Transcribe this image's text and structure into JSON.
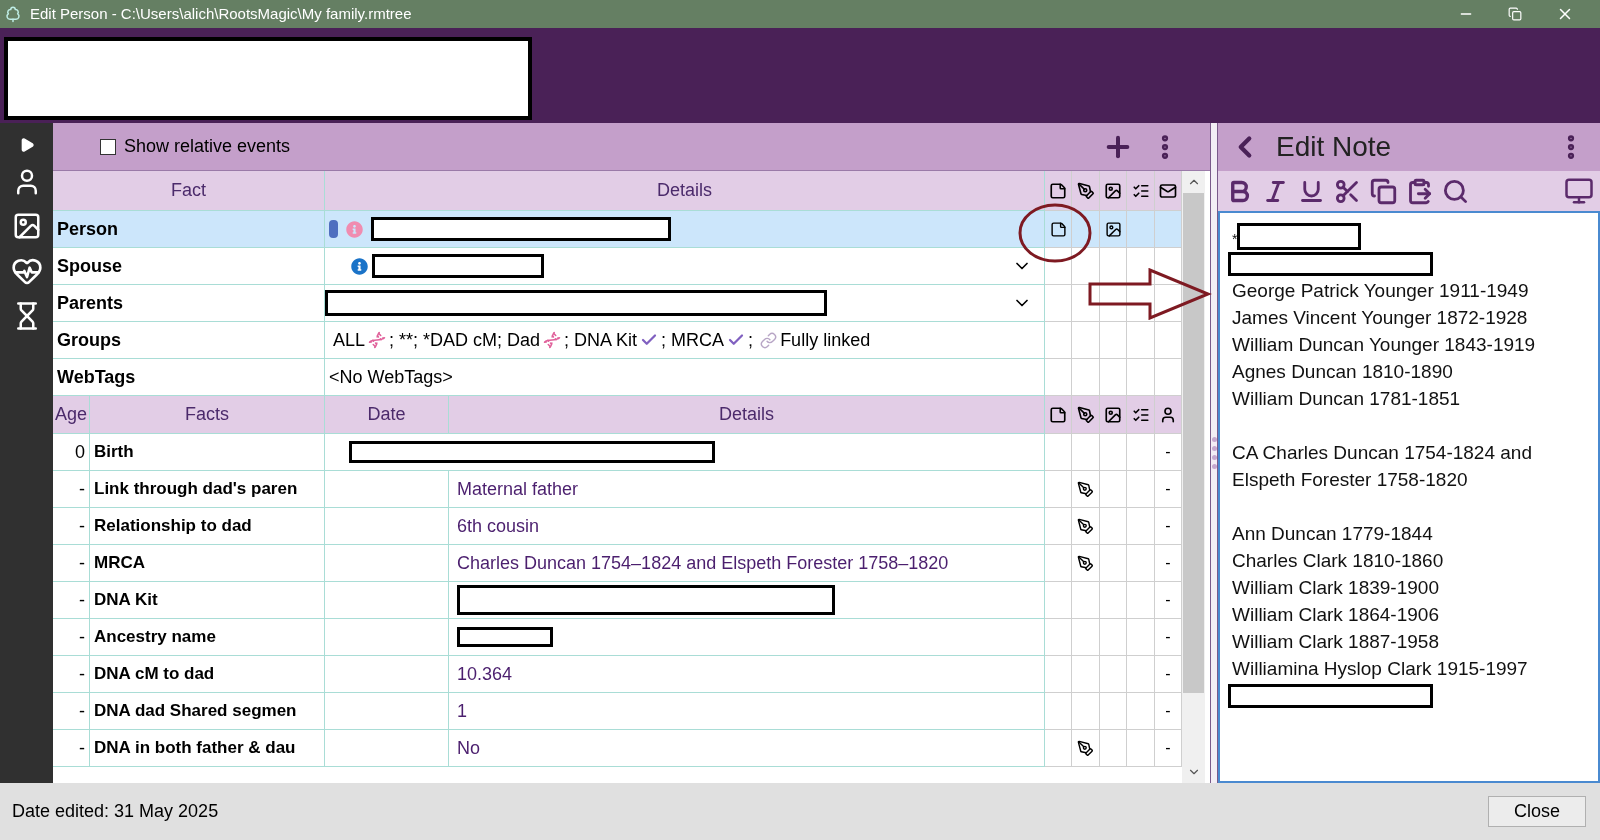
{
  "window": {
    "title": "Edit Person - C:\\Users\\alich\\RootsMagic\\My family.rmtree"
  },
  "header": {
    "name_redacted": true
  },
  "toolbar": {
    "checkbox": {
      "label": "Show relative events",
      "checked": false
    }
  },
  "fact_table": {
    "columns": [
      "Fact",
      "Details"
    ],
    "rows": [
      {
        "kind": "person",
        "fact": "Person",
        "selected": true,
        "redacted": true,
        "dropdown": false,
        "note": true,
        "citation": false,
        "media": true
      },
      {
        "kind": "spouse",
        "fact": "Spouse",
        "selected": false,
        "redacted": true,
        "dropdown": true,
        "note": false,
        "citation": false,
        "media": false
      },
      {
        "kind": "parents",
        "fact": "Parents",
        "selected": false,
        "redacted": true,
        "dropdown": true,
        "note": false,
        "citation": false,
        "media": false
      },
      {
        "kind": "groups",
        "fact": "Groups",
        "selected": false,
        "segments": [
          {
            "kind": "text",
            "text": "ALL"
          },
          {
            "kind": "dna"
          },
          {
            "kind": "text",
            "text": "; **; *DAD cM; Dad"
          },
          {
            "kind": "dna"
          },
          {
            "kind": "text",
            "text": "; DNA Kit"
          },
          {
            "kind": "check"
          },
          {
            "kind": "text",
            "text": "; MRCA"
          },
          {
            "kind": "check"
          },
          {
            "kind": "text",
            "text": ";"
          },
          {
            "kind": "link"
          },
          {
            "kind": "text",
            "text": "Fully linked"
          }
        ]
      },
      {
        "kind": "webtags",
        "fact": "WebTags",
        "selected": false,
        "details": "<No WebTags>"
      }
    ]
  },
  "events_table": {
    "columns": [
      "Age",
      "Facts",
      "Date",
      "Details"
    ],
    "rows": [
      {
        "kind": "redacted_wide",
        "age": "0",
        "fact": "Birth",
        "citation": false,
        "flag": "-"
      },
      {
        "kind": "text",
        "age": "-",
        "fact": "Link through dad's paren",
        "details": "Maternal father",
        "citation": true,
        "flag": "-"
      },
      {
        "kind": "text",
        "age": "-",
        "fact": "Relationship to dad",
        "details": "6th cousin",
        "citation": true,
        "flag": "-"
      },
      {
        "kind": "text",
        "age": "-",
        "fact": "MRCA",
        "details": "Charles Duncan 1754–1824 and Elspeth Forester 1758–1820",
        "citation": true,
        "flag": "-"
      },
      {
        "kind": "redacted_long",
        "age": "-",
        "fact": "DNA Kit",
        "citation": false,
        "flag": "-"
      },
      {
        "kind": "redacted_short",
        "age": "-",
        "fact": "Ancestry name",
        "citation": false,
        "flag": "-"
      },
      {
        "kind": "text",
        "age": "-",
        "fact": "DNA cM to dad",
        "details": "10.364",
        "citation": false,
        "flag": "-"
      },
      {
        "kind": "text",
        "age": "-",
        "fact": "DNA dad Shared segmen",
        "details": "1",
        "citation": false,
        "flag": "-"
      },
      {
        "kind": "text",
        "age": "-",
        "fact": "DNA in both father & dau",
        "details": "No",
        "citation": true,
        "flag": "-"
      }
    ]
  },
  "note": {
    "title": "Edit Note",
    "lines": [
      {
        "kind": "redacted",
        "text": "*"
      },
      {
        "kind": "redacted_wide"
      },
      {
        "kind": "text",
        "text": "George Patrick Younger 1911-1949"
      },
      {
        "kind": "text",
        "text": "James Vincent Younger 1872-1928"
      },
      {
        "kind": "text",
        "text": "William Duncan Younger 1843-1919"
      },
      {
        "kind": "text",
        "text": "Agnes Duncan 1810-1890"
      },
      {
        "kind": "text",
        "text": "William Duncan 1781-1851"
      },
      {
        "kind": "blank"
      },
      {
        "kind": "text",
        "text": "CA Charles Duncan 1754-1824 and"
      },
      {
        "kind": "text",
        "text": "Elspeth Forester 1758-1820"
      },
      {
        "kind": "blank"
      },
      {
        "kind": "text",
        "text": "Ann Duncan 1779-1844"
      },
      {
        "kind": "text",
        "text": "Charles Clark 1810-1860"
      },
      {
        "kind": "text",
        "text": "William Clark 1839-1900"
      },
      {
        "kind": "text",
        "text": "William Clark 1864-1906"
      },
      {
        "kind": "text",
        "text": "William Clark 1887-1958"
      },
      {
        "kind": "text",
        "text": "Williamina Hyslop Clark 1915-1997"
      },
      {
        "kind": "redacted_wide"
      }
    ]
  },
  "footer": {
    "date_edited": "Date edited: 31 May 2025",
    "close": "Close"
  },
  "annotations": [
    {
      "kind": "circle"
    },
    {
      "kind": "arrow"
    }
  ]
}
